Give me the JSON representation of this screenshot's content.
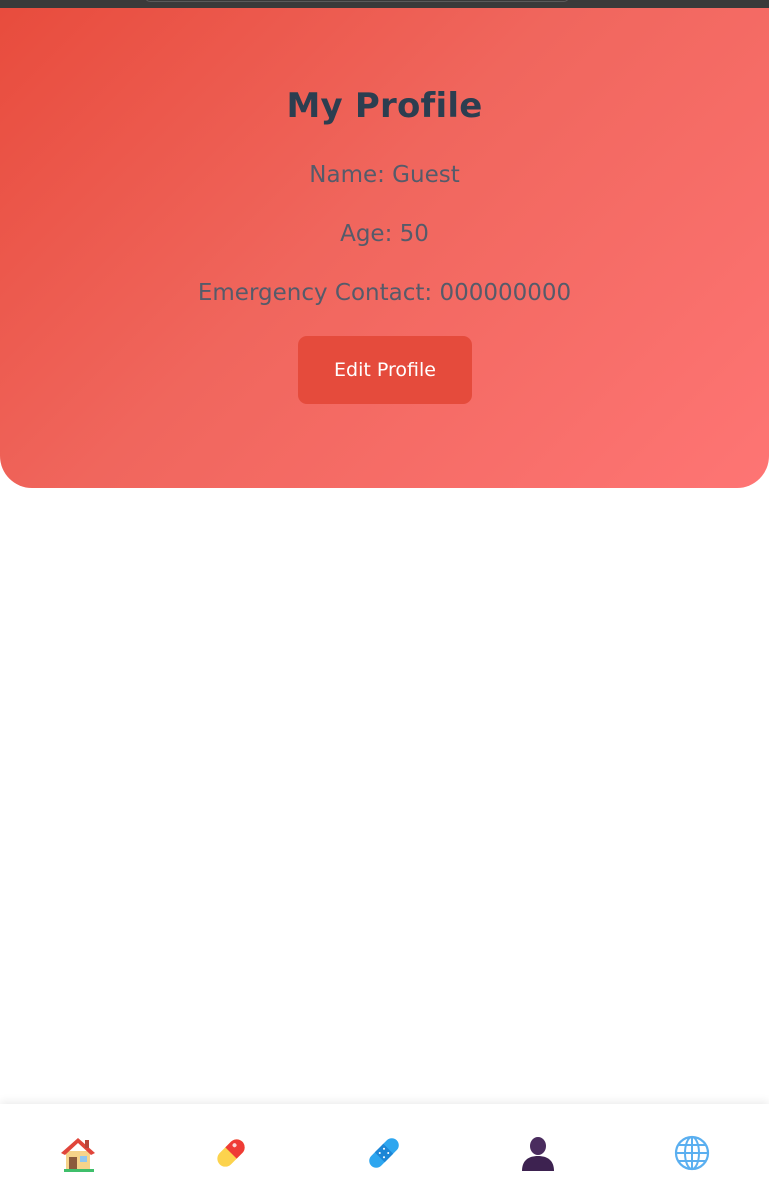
{
  "profile": {
    "title": "My Profile",
    "name_line": "Name: Guest",
    "age_line": "Age: 50",
    "contact_line": "Emergency Contact: 000000000",
    "edit_label": "Edit Profile"
  },
  "nav": {
    "items": [
      {
        "icon": "house-icon"
      },
      {
        "icon": "pill-icon"
      },
      {
        "icon": "bandage-icon"
      },
      {
        "icon": "person-icon"
      },
      {
        "icon": "globe-icon"
      }
    ]
  },
  "colors": {
    "gradient_start": "#e84c3d",
    "gradient_end": "#fe7574",
    "title": "#2c3e50",
    "info_text": "#555b6a",
    "button": "#e54b3c"
  }
}
